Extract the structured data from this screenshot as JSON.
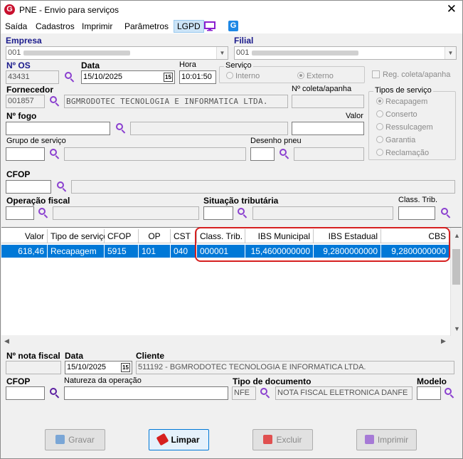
{
  "window": {
    "title": "PNE - Envio para serviços",
    "close_glyph": "✕"
  },
  "menu": [
    "Saída",
    "Cadastros",
    "Imprimir",
    "Parâmetros",
    "LGPD"
  ],
  "form": {
    "empresa_label": "Empresa",
    "empresa_value": "001",
    "filial_label": "Filial",
    "filial_value": "001",
    "os_label": "Nº  OS",
    "os_value": "43431",
    "data_label": "Data",
    "data_value": "15/10/2025",
    "hora_label": "Hora",
    "hora_value": "10:01:50",
    "servico_label": "Serviço",
    "interno_label": "Interno",
    "externo_label": "Externo",
    "reg_coleta_label": "Reg. coleta/apanha",
    "fornecedor_label": "Fornecedor",
    "fornecedor_code": "001857",
    "fornecedor_name": "BGMRODOTEC TECNOLOGIA E INFORMATICA LTDA.",
    "ncoleta_label": "Nº coleta/apanha",
    "tipos_label": "Tipos de serviço",
    "tipos": [
      "Recapagem",
      "Conserto",
      "Ressulcagem",
      "Garantia",
      "Reclamação"
    ],
    "fogo_label": "Nº  fogo",
    "valor_label": "Valor",
    "grupo_label": "Grupo de serviço",
    "desenho_label": "Desenho pneu",
    "cfop_label": "CFOP",
    "operacao_label": "Operação fiscal",
    "situacao_label": "Situação tributária",
    "classtrib_label": "Class. Trib."
  },
  "grid": {
    "headers": [
      "Valor",
      "Tipo de serviço",
      "CFOP",
      "OP",
      "CST",
      "Class. Trib.",
      "IBS Municipal",
      "IBS Estadual",
      "CBS"
    ],
    "row": [
      "618,46",
      "Recapagem",
      "5915",
      "101",
      "040",
      "000001",
      "15,4600000000",
      "9,2800000000",
      "9,2800000000"
    ]
  },
  "footer": {
    "nota_label": "Nº nota fiscal",
    "data_label": "Data",
    "data_value": "15/10/2025",
    "cliente_label": "Cliente",
    "cliente_value": "511192 - BGMRODOTEC TECNOLOGIA E INFORMATICA LTDA.",
    "cfop_label": "CFOP",
    "natureza_label": "Natureza da operação",
    "tipodoc_label": "Tipo de documento",
    "tipodoc_code": "NFE",
    "tipodoc_value": "NOTA FISCAL ELETRONICA DANFE",
    "modelo_label": "Modelo"
  },
  "buttons": {
    "gravar": "Gravar",
    "limpar": "Limpar",
    "excluir": "Excluir",
    "imprimir": "Imprimir"
  },
  "colors": {
    "selection": "#0078d7",
    "highlight": "#d62020",
    "brand": "#c8102e",
    "search_icon": "#8a3fcf"
  }
}
